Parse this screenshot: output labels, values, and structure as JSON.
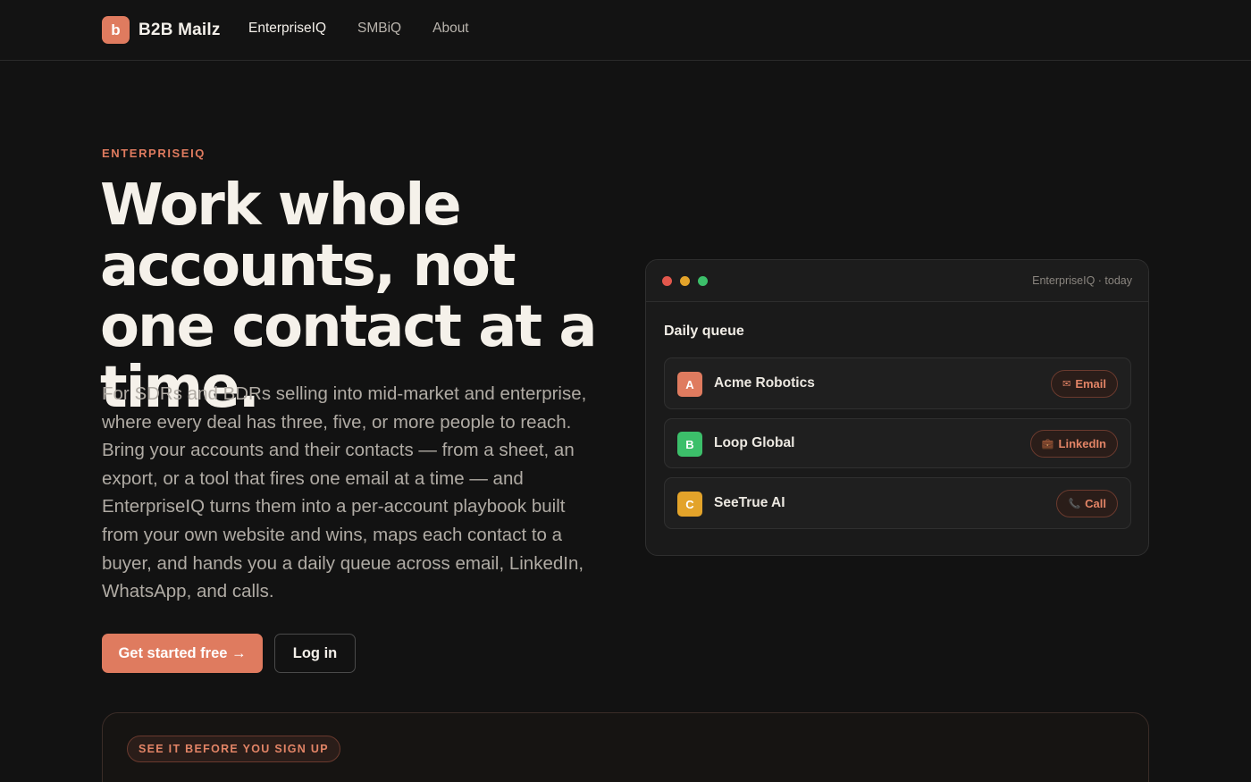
{
  "nav": {
    "brand_mark": "b",
    "brand_name": "B2B Mailz",
    "links": [
      {
        "label": "EnterpriseIQ",
        "active": true
      },
      {
        "label": "SMBiQ",
        "active": false
      },
      {
        "label": "About",
        "active": false
      }
    ]
  },
  "hero": {
    "eyebrow": "ENTERPRISEIQ",
    "headline": "Work whole accounts, not one contact at a time.",
    "lede": "For SDRs and BDRs selling into mid-market and enterprise, where every deal has three, five, or more people to reach. Bring your accounts and their contacts — from a sheet, an export, or a tool that fires one email at a time — and EnterpriseIQ turns them into a per-account playbook built from your own website and wins, maps each contact to a buyer, and hands you a daily queue across email, LinkedIn, WhatsApp, and calls.",
    "primary_cta": "Get started free →",
    "secondary_cta": "Log in"
  },
  "window": {
    "title": "EnterpriseIQ · today",
    "queue_title": "Daily queue",
    "items": [
      {
        "letter": "A",
        "name": "Acme Robotics",
        "channel_icon": "✉",
        "channel": "Email",
        "color": "#df7b5f"
      },
      {
        "letter": "B",
        "name": "Loop Global",
        "channel_icon": "💼",
        "channel": "LinkedIn",
        "color": "#3cbf6a"
      },
      {
        "letter": "C",
        "name": "SeeTrue AI",
        "channel_icon": "📞",
        "channel": "Call",
        "color": "#e3a32a"
      }
    ]
  },
  "panel": {
    "pill": "SEE IT BEFORE YOU SIGN UP"
  },
  "colors": {
    "accent": "#df7b5f",
    "background": "#121212"
  }
}
